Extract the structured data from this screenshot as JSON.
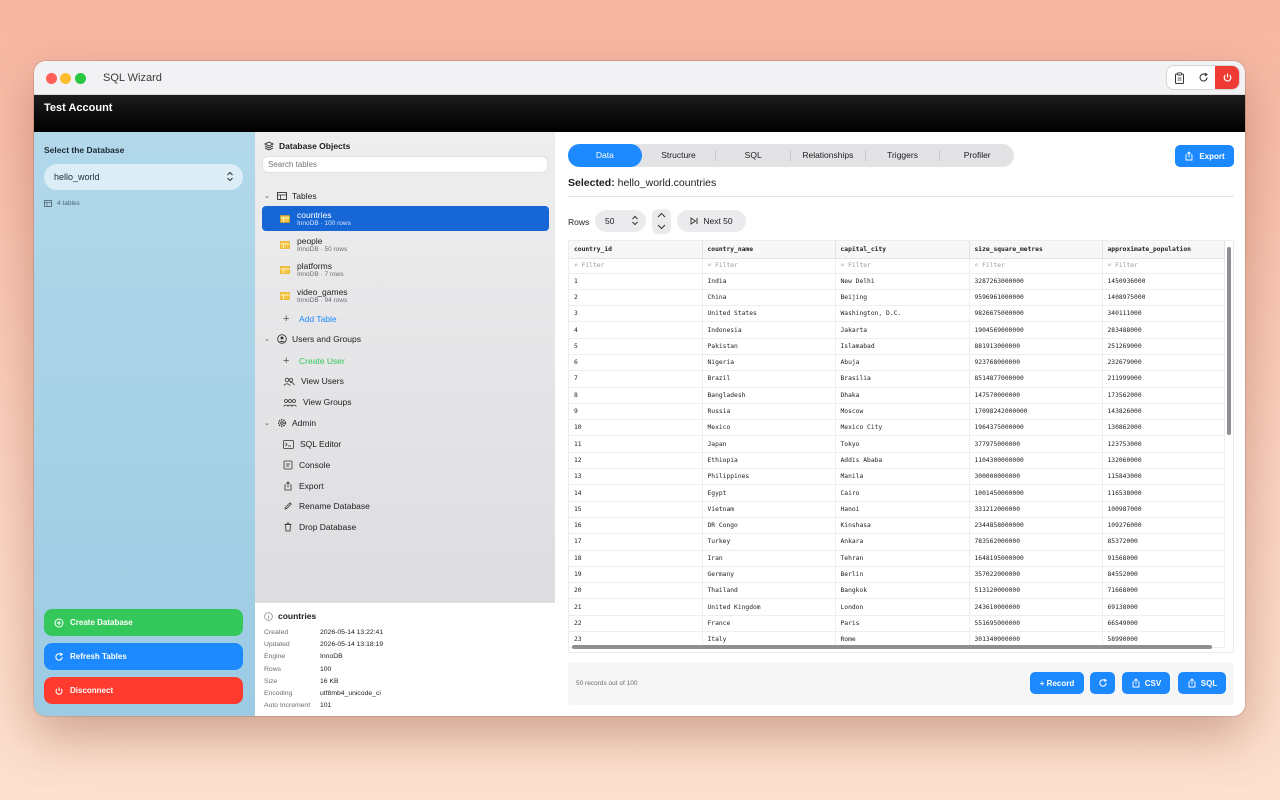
{
  "app": {
    "title": "SQL Wizard"
  },
  "account": {
    "name": "Test Account"
  },
  "sidebar": {
    "label": "Select the Database",
    "database": "hello_world",
    "table_count": "4 tables",
    "buttons": {
      "create": "Create Database",
      "refresh": "Refresh Tables",
      "disconnect": "Disconnect"
    }
  },
  "objects": {
    "title": "Database Objects",
    "search_placeholder": "Search tables",
    "tables_label": "Tables",
    "tables": [
      {
        "name": "countries",
        "meta": "InnoDB · 100 rows"
      },
      {
        "name": "people",
        "meta": "InnoDB · 50 rows"
      },
      {
        "name": "platforms",
        "meta": "InnoDB · 7 rows"
      },
      {
        "name": "video_games",
        "meta": "InnoDB · 94 rows"
      }
    ],
    "add_table": "Add Table",
    "users_label": "Users and Groups",
    "create_user": "Create User",
    "view_users": "View Users",
    "view_groups": "View Groups",
    "admin_label": "Admin",
    "admin_items": [
      "SQL Editor",
      "Console",
      "Export",
      "Rename Database",
      "Drop Database"
    ]
  },
  "info": {
    "title": "countries",
    "rows": [
      {
        "k": "Created",
        "v": "2026-05-14 13:22:41"
      },
      {
        "k": "Updated",
        "v": "2026-05-14 13:18:19"
      },
      {
        "k": "Engine",
        "v": "InnoDB"
      },
      {
        "k": "Rows",
        "v": "100"
      },
      {
        "k": "Size",
        "v": "16 KB"
      },
      {
        "k": "Encoding",
        "v": "utf8mb4_unicode_ci"
      },
      {
        "k": "Auto Increment",
        "v": "101"
      }
    ]
  },
  "main": {
    "tabs": [
      "Data",
      "Structure",
      "SQL",
      "Relationships",
      "Triggers",
      "Profiler"
    ],
    "export": "Export",
    "selected_label": "Selected:",
    "selected_value": "hello_world.countries",
    "rows_label": "Rows",
    "rows_value": "50",
    "next": "Next 50",
    "filter_placeholder": "Filter",
    "columns": [
      "country_id",
      "country_name",
      "capital_city",
      "size_square_metres",
      "approximate_population"
    ],
    "data": [
      [
        "1",
        "India",
        "New Delhi",
        "3287263000000",
        "1450936000"
      ],
      [
        "2",
        "China",
        "Beijing",
        "9596961000000",
        "1408975000"
      ],
      [
        "3",
        "United States",
        "Washington, D.C.",
        "9826675000000",
        "340111000"
      ],
      [
        "4",
        "Indonesia",
        "Jakarta",
        "1904569000000",
        "283488000"
      ],
      [
        "5",
        "Pakistan",
        "Islamabad",
        "881913000000",
        "251269000"
      ],
      [
        "6",
        "Nigeria",
        "Abuja",
        "923768000000",
        "232679000"
      ],
      [
        "7",
        "Brazil",
        "Brasilia",
        "8514877000000",
        "211999000"
      ],
      [
        "8",
        "Bangladesh",
        "Dhaka",
        "147570000000",
        "173562000"
      ],
      [
        "9",
        "Russia",
        "Moscow",
        "17098242000000",
        "143826000"
      ],
      [
        "10",
        "Mexico",
        "Mexico City",
        "1964375000000",
        "130862000"
      ],
      [
        "11",
        "Japan",
        "Tokyo",
        "377975000000",
        "123753000"
      ],
      [
        "12",
        "Ethiopia",
        "Addis Ababa",
        "1104300000000",
        "132060000"
      ],
      [
        "13",
        "Philippines",
        "Manila",
        "300000000000",
        "115843000"
      ],
      [
        "14",
        "Egypt",
        "Cairo",
        "1001450000000",
        "116538000"
      ],
      [
        "15",
        "Vietnam",
        "Hanoi",
        "331212000000",
        "100987000"
      ],
      [
        "16",
        "DR Congo",
        "Kinshasa",
        "2344858000000",
        "109276000"
      ],
      [
        "17",
        "Turkey",
        "Ankara",
        "783562000000",
        "85372000"
      ],
      [
        "18",
        "Iran",
        "Tehran",
        "1648195000000",
        "91568000"
      ],
      [
        "19",
        "Germany",
        "Berlin",
        "357022000000",
        "84552000"
      ],
      [
        "20",
        "Thailand",
        "Bangkok",
        "513120000000",
        "71668000"
      ],
      [
        "21",
        "United Kingdom",
        "London",
        "243610000000",
        "69138000"
      ],
      [
        "22",
        "France",
        "Paris",
        "551695000000",
        "66549000"
      ],
      [
        "23",
        "Italy",
        "Rome",
        "301340000000",
        "58990000"
      ]
    ],
    "record_count": "50 records out of 100",
    "footer_buttons": {
      "record": "+ Record",
      "csv": "CSV",
      "sql": "SQL"
    }
  },
  "colors": {
    "accent": "#1c8afe",
    "success": "#34c759",
    "danger": "#ff3b30",
    "selection": "#1666d6"
  },
  "icons": [
    "clipboard-icon",
    "refresh-icon",
    "power-icon",
    "layers-icon",
    "table-icon",
    "plus-icon",
    "user-circle-icon",
    "users-icon",
    "user-group-icon",
    "gear-icon",
    "terminal-icon",
    "export-icon",
    "pencil-icon",
    "trash-icon",
    "info-icon",
    "search-icon"
  ]
}
